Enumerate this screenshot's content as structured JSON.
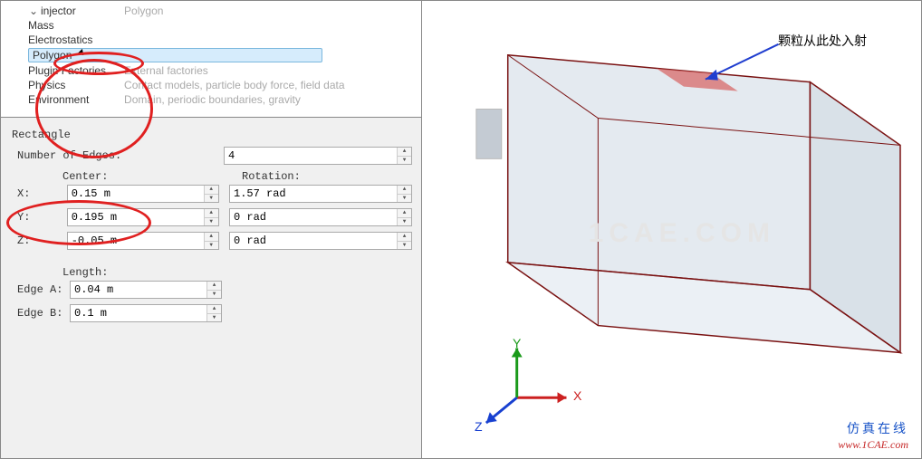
{
  "tree": {
    "injector": {
      "label": "injector",
      "value": "Polygon"
    },
    "mass": {
      "label": "Mass"
    },
    "electro": {
      "label": "Electrostatics"
    },
    "polygon": {
      "label": "Polygon"
    },
    "plugin": {
      "label": "Plugin Factories",
      "value": "External factories"
    },
    "physics": {
      "label": "Physics",
      "value": "Contact models, particle body force, field data"
    },
    "environment": {
      "label": "Environment",
      "value": "Domain, periodic boundaries, gravity"
    }
  },
  "props": {
    "title": "Rectangle",
    "edges_label": "Number of Edges:",
    "edges_value": "4",
    "center_label": "Center:",
    "rotation_label": "Rotation:",
    "x_label": "X:",
    "x_val": "0.15 m",
    "x_rot": "1.57 rad",
    "y_label": "Y:",
    "y_val": "0.195 m",
    "y_rot": "0 rad",
    "z_label": "Z:",
    "z_val": "-0.05 m",
    "z_rot": "0 rad",
    "length_label": "Length:",
    "edgeA_label": "Edge A:",
    "edgeA_val": "0.04 m",
    "edgeB_label": "Edge B:",
    "edgeB_val": "0.1 m"
  },
  "view": {
    "annotation": "颗粒从此处入射",
    "axis_x": "X",
    "axis_y": "Y",
    "axis_z": "Z",
    "watermark": "1CAE.COM"
  },
  "credit": {
    "cn": "仿真在线",
    "url": "www.1CAE.com"
  }
}
